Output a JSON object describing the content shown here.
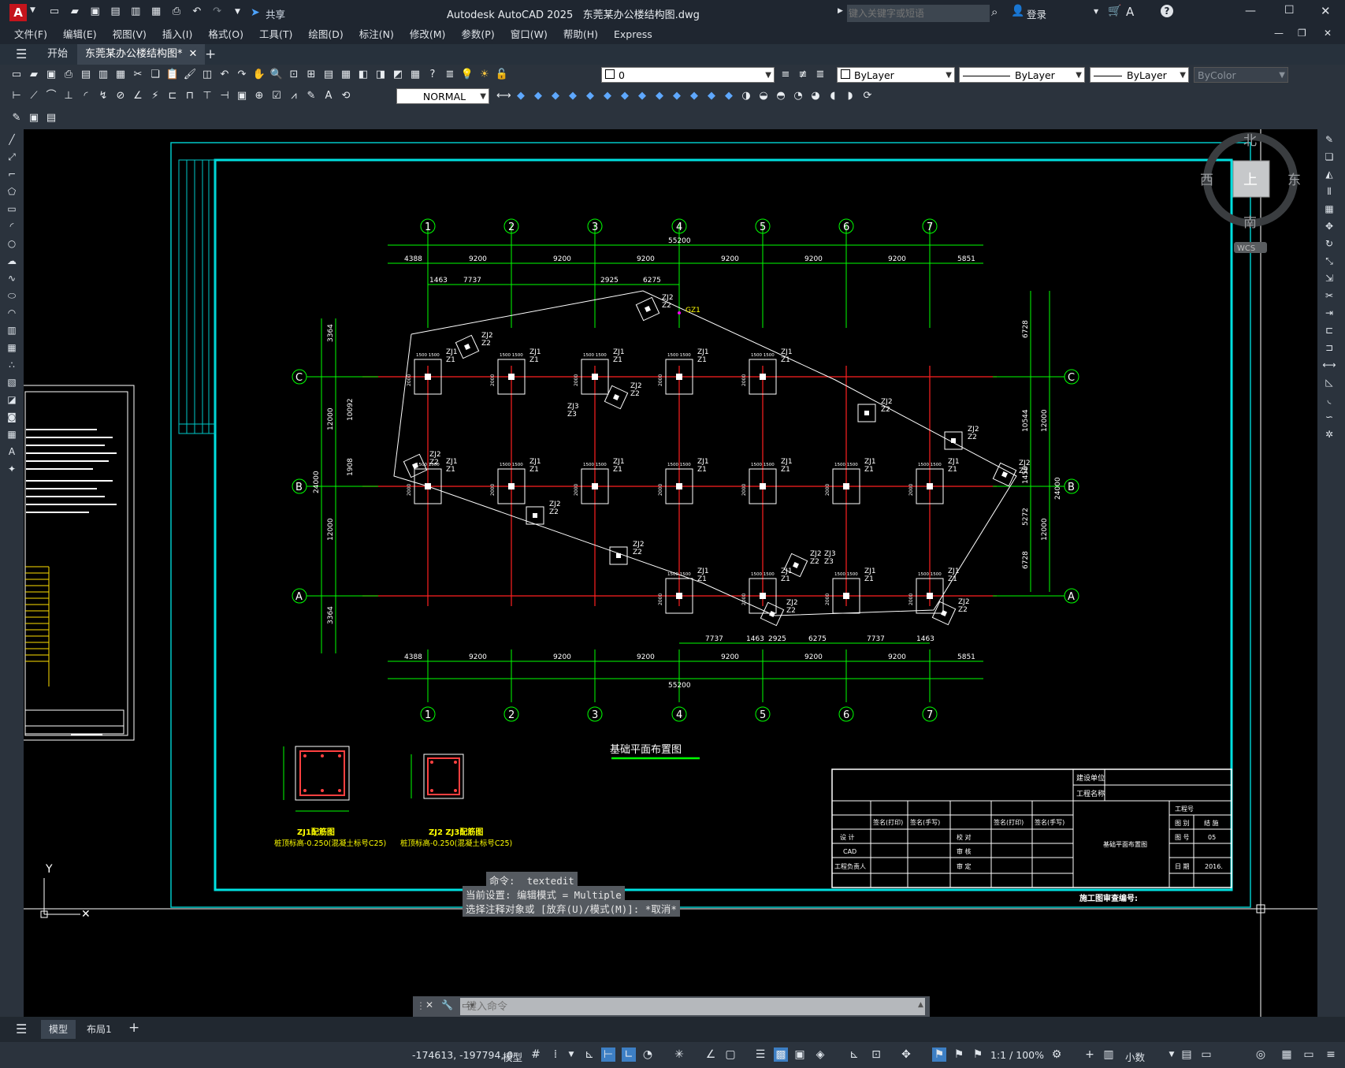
{
  "app": {
    "title": "Autodesk AutoCAD 2025",
    "file": "东莞某办公楼结构图.dwg",
    "share": "共享",
    "search_placeholder": "键入关键字或短语",
    "login": "登录"
  },
  "menu": [
    "文件(F)",
    "编辑(E)",
    "视图(V)",
    "插入(I)",
    "格式(O)",
    "工具(T)",
    "绘图(D)",
    "标注(N)",
    "修改(M)",
    "参数(P)",
    "窗口(W)",
    "帮助(H)",
    "Express"
  ],
  "tabs": {
    "start": "开始",
    "active": "东莞某办公楼结构图*"
  },
  "props": {
    "layer": "0",
    "color": "ByLayer",
    "linetype": "ByLayer",
    "lineweight": "ByLayer",
    "plotstyle": "ByColor",
    "textstyle": "NORMAL"
  },
  "viewcube": {
    "north": "北",
    "south": "南",
    "east": "东",
    "west": "西",
    "top": "上",
    "wcs": "WCS"
  },
  "drawing": {
    "axes_num": [
      "1",
      "2",
      "3",
      "4",
      "5",
      "6",
      "7"
    ],
    "axes_letter": [
      "C",
      "B",
      "A"
    ],
    "total_width": "55200",
    "total_depth": "24000",
    "dims_top": [
      "4388",
      "9200",
      "9200",
      "9200",
      "9200",
      "9200",
      "9200",
      "5851"
    ],
    "dims_top2": [
      "1463",
      "7737",
      "2925",
      "6275"
    ],
    "dims_bottom2": [
      "7737",
      "1463",
      "2925",
      "6275",
      "7737",
      "1463"
    ],
    "dims_left": [
      "3364",
      "12000",
      "12000",
      "3364",
      "10092",
      "1908"
    ],
    "dims_right": [
      "6728",
      "10544",
      "1456",
      "5272",
      "6728",
      "12000",
      "12000"
    ],
    "plan_title": "基础平面布置图",
    "gz_label": "GZ1",
    "section1_title": "ZJ1配筋图",
    "section1_note": "桩顶标高-0.250(混凝土标号C25)",
    "section2_title": "ZJ2 ZJ3配筋图",
    "section2_note": "桩顶标高-0.250(混凝土标号C25)",
    "labels": {
      "zj1": "ZJ1",
      "zj2": "ZJ2",
      "zj3": "ZJ3",
      "z1": "Z1",
      "z2": "Z2",
      "z3": "Z3",
      "d2000": "2000",
      "d1500": "1500 1500"
    },
    "titleblock": {
      "construction_unit": "建设单位",
      "project_name": "工程名称",
      "sign1": "签名(打印)",
      "sign2": "签名(手写)",
      "design": "设 计",
      "cad": "CAD",
      "manager": "工程负责人",
      "check": "校 对",
      "review": "审 核",
      "approve": "审 定",
      "drawing_name": "基础平面布置图",
      "job_no": "工程号",
      "drawing_class": "图 别",
      "drawing_class_val": "结 施",
      "drawing_no": "图 号",
      "drawing_no_val": "05",
      "date": "日 期",
      "date_val": "2016.",
      "review_no": "施工图审查编号:"
    }
  },
  "command": {
    "history": [
      "命令: _textedit",
      "当前设置: 编辑模式 = Multiple",
      "选择注释对象或 [放弃(U)/模式(M)]: *取消*"
    ],
    "placeholder": "键入命令"
  },
  "layouts": {
    "model": "模型",
    "layout1": "布局1"
  },
  "status": {
    "coords": "-174613, -197794, 0",
    "model": "模型",
    "scale": "1:1 / 100%",
    "units": "小数"
  }
}
